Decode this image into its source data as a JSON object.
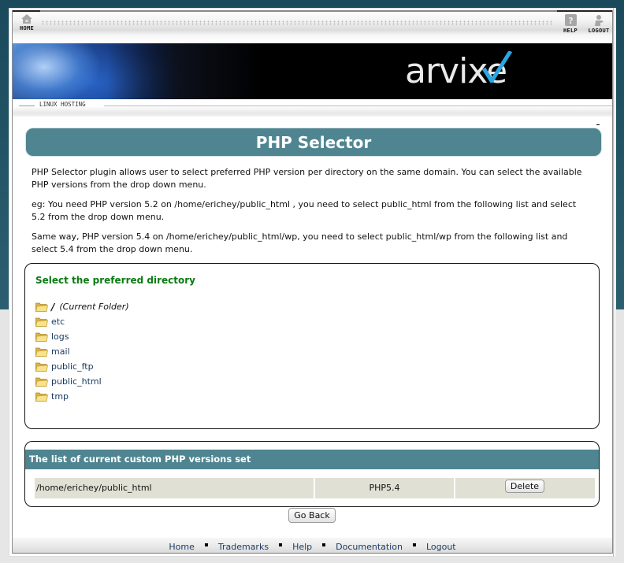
{
  "topnav": {
    "home_label": "HOME",
    "help_label": "HELP",
    "logout_label": "LOGOUT"
  },
  "banner": {
    "logo_text": "arvixe",
    "accent_color": "#2aa7e0"
  },
  "hosting_label": "LINUX HOSTING",
  "page_title": "PHP Selector",
  "intro": {
    "p1": "PHP Selector plugin allows user to select preferred PHP version per directory on the same domain. You can select the available PHP versions from the drop down menu.",
    "p2": "eg: You need PHP version 5.2 on /home/erichey/public_html , you need to select public_html from the following list and select 5.2 from the drop down menu.",
    "p3": "Same way, PHP version 5.4 on /home/erichey/public_html/wp, you need to select public_html/wp from the following list and select 5.4 from the drop down menu."
  },
  "directory": {
    "title": "Select the preferred directory",
    "root": {
      "name": "/",
      "note": "(Current Folder)"
    },
    "items": [
      "etc",
      "logs",
      "mail",
      "public_ftp",
      "public_html",
      "tmp"
    ]
  },
  "versions": {
    "title": "The list of current custom PHP versions set",
    "rows": [
      {
        "path": "/home/erichey/public_html",
        "version": "PHP5.4",
        "action": "Delete"
      }
    ]
  },
  "go_back_label": "Go Back",
  "footer": {
    "links": [
      "Home",
      "Trademarks",
      "Help",
      "Documentation",
      "Logout"
    ]
  },
  "colors": {
    "header_teal": "#4f8591",
    "heading_green": "#0a7a12",
    "link_navy": "#16385f",
    "row_bg": "#e0e0d4"
  }
}
